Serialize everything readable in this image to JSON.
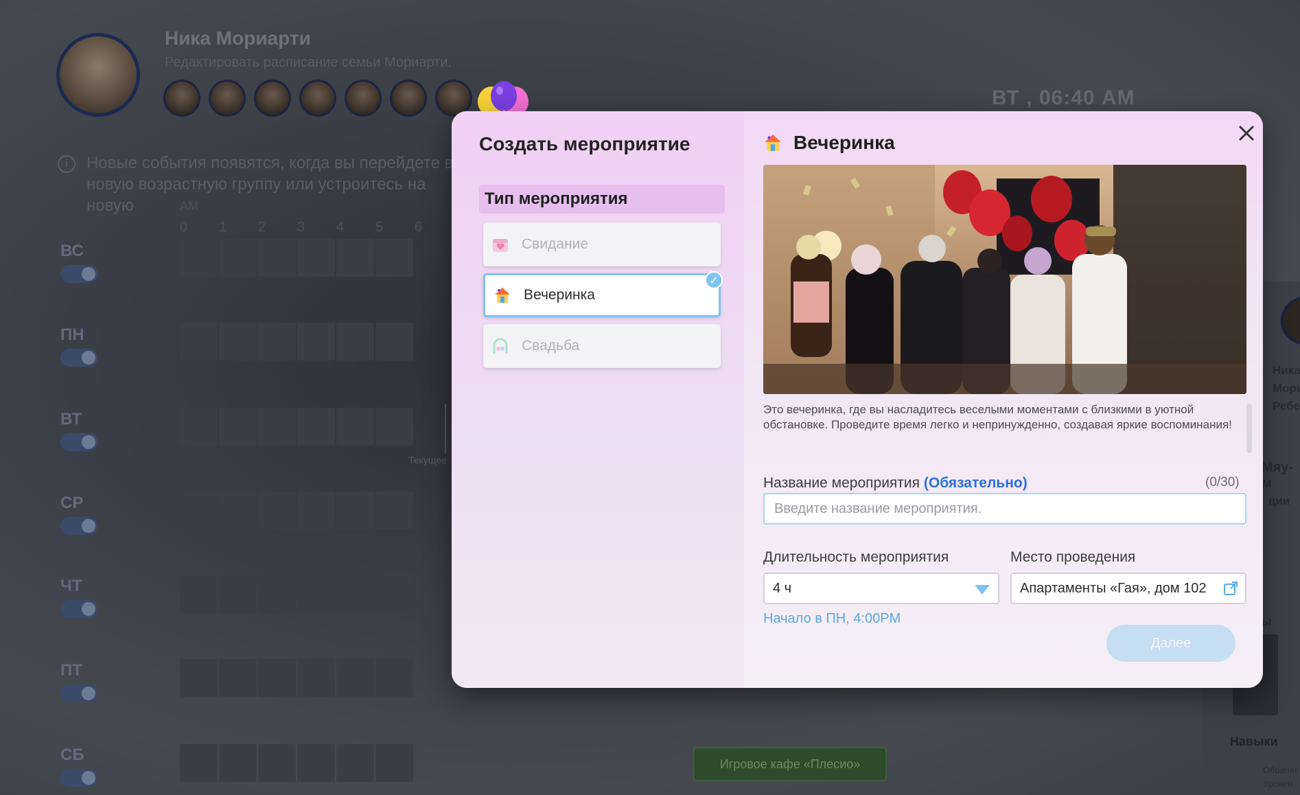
{
  "background": {
    "profile": {
      "name": "Ника Мориарти",
      "subtitle": "Редактировать расписание семьи Мориарти."
    },
    "clock": "ВТ , 06:40 AM",
    "notice": "Новые события появятся, когда вы перейдете в новую возрастную группу или устроитесь на новую",
    "am_label": "AM",
    "hours": [
      "0",
      "1",
      "2",
      "3",
      "4",
      "5",
      "6"
    ],
    "days": [
      "ВС",
      "ПН",
      "ВТ",
      "СР",
      "ЧТ",
      "ПТ",
      "СБ"
    ],
    "current_time_label": "Текущее",
    "cafe_event": "Игровое кафе «Плесио»",
    "right_panel": {
      "name_lines": [
        "Ника",
        "Мори",
        "Ребе"
      ],
      "tag": "Мяу-м",
      "section_actions": "ции",
      "section_y": "ы",
      "skills": "Навыки",
      "skill_item": "Общени",
      "skill_level": "Уровен"
    }
  },
  "modal": {
    "title": "Создать мероприятие",
    "type_section_label": "Тип мероприятия",
    "event_types": [
      {
        "label": "Свидание",
        "icon": "calendar-heart-icon",
        "selected": false
      },
      {
        "label": "Вечеринка",
        "icon": "party-house-icon",
        "selected": true
      },
      {
        "label": "Свадьба",
        "icon": "wedding-arch-icon",
        "selected": false
      }
    ],
    "selected_event": {
      "title": "Вечеринка",
      "description": "Это вечеринка, где вы насладитесь веселыми моментами с близкими в уютной обстановке. Проведите время легко и непринужденно, создавая яркие воспоминания!"
    },
    "name_field": {
      "label": "Название мероприятия",
      "required": "(Обязательно)",
      "counter": "(0/30)",
      "placeholder": "Введите название мероприятия."
    },
    "duration_field": {
      "label": "Длительность мероприятия",
      "value": "4 ч"
    },
    "venue_field": {
      "label": "Место проведения",
      "value": "Апартаменты «Гая», дом 102"
    },
    "start_note": "Начало в ПН, 4:00PM",
    "next_label": "Далее"
  },
  "colors": {
    "accent_blue": "#7fc4f3",
    "required_blue": "#2d6fe0",
    "modal_pink": "#f2d6f4"
  }
}
